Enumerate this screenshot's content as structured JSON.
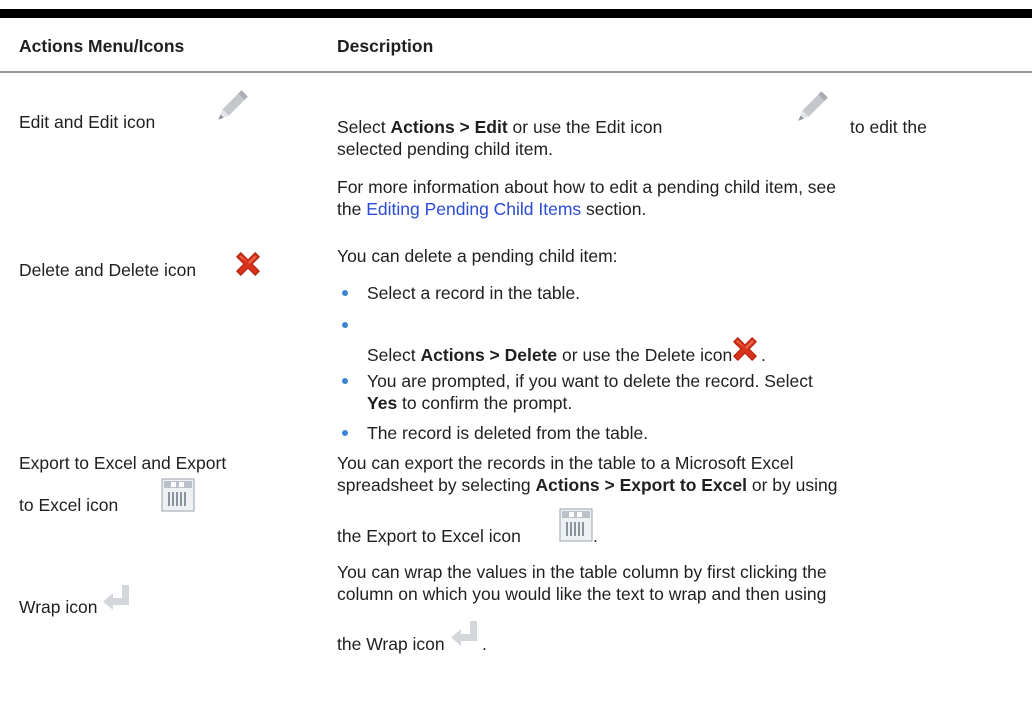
{
  "header": {
    "col1": "Actions Menu/Icons",
    "col2": "Description"
  },
  "rows": {
    "edit": {
      "label": "Edit and Edit icon",
      "icon": "pencil-icon",
      "d1_pre": "Select ",
      "d1_bold": "Actions > Edit",
      "d1_mid": " or use the Edit icon ",
      "d1_post": " to edit the",
      "d1_line2": "selected pending child item.",
      "d2_line1": "For more information about how to edit a pending child item, see",
      "d2_pre": "the ",
      "d2_link": "Editing Pending Child Items",
      "d2_post": " section."
    },
    "delete": {
      "label": "Delete and Delete icon",
      "icon": "red-x-icon",
      "intro": "You can delete a pending child item:",
      "b1": "Select a record in the table.",
      "b2_pre": "Select ",
      "b2_bold": "Actions > Delete",
      "b2_mid": " or use the Delete icon ",
      "b2_post": ".",
      "b3_line1": "You are prompted, if you want to delete the record. Select",
      "b3_bold": "Yes",
      "b3_post": " to confirm the prompt.",
      "b4": "The record is deleted from the table."
    },
    "export": {
      "label_line1": "Export to Excel and Export",
      "label_line2": "to Excel icon",
      "icon": "excel-export-icon",
      "line1": "You can export the records in the table to a Microsoft Excel",
      "line2_pre": "spreadsheet by selecting ",
      "line2_bold": "Actions > Export to Excel",
      "line2_post": " or by using",
      "line3": "the Export to Excel icon ",
      "line3_post": "."
    },
    "wrap": {
      "label": "Wrap icon",
      "icon": "wrap-arrow-icon",
      "line1": "You can wrap the values in the table column by first clicking the",
      "line2": "column on which you would like the text to wrap and then using",
      "line3": "the Wrap icon ",
      "line3_post": "."
    }
  },
  "colors": {
    "bullet": "#3a86d4",
    "link": "#2a4bd6",
    "delete_icon": "#d8321a"
  }
}
